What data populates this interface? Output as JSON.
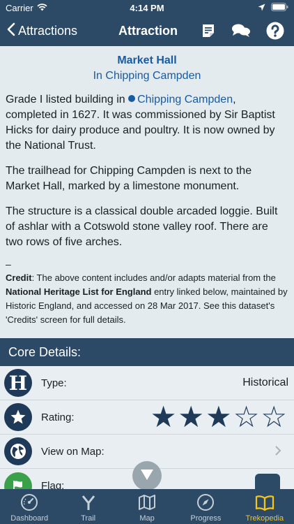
{
  "status": {
    "carrier": "Carrier",
    "time": "4:14 PM"
  },
  "nav": {
    "back_label": "Attractions",
    "title": "Attraction"
  },
  "article": {
    "title": "Market Hall",
    "subtitle": "In Chipping Campden",
    "p1_before": "Grade I listed building in ",
    "p1_link": "Chipping Campden",
    "p1_after": ", completed in 1627. It was commissioned by Sir Baptist Hicks for dairy produce and poultry. It is now owned by the National Trust.",
    "p2": "The trailhead for Chipping Campden is next to the Market Hall, marked by a limestone monument.",
    "p3": "The structure is a classical double arcaded loggie. Built of ashlar with a Cotswold stone valley roof. There are two rows of five arches.",
    "dash": "–",
    "credit_label": "Credit",
    "credit_text1": ": The above content includes and/or adapts material from the ",
    "credit_bold": "National Heritage List for England",
    "credit_text2": " entry linked below, maintained by Historic England, and accessed on 28 Mar 2017. See this dataset's 'Credits' screen for full details."
  },
  "core": {
    "header": "Core Details:",
    "type_label": "Type:",
    "type_value": "Historical",
    "type_icon_letter": "H",
    "rating_label": "Rating:",
    "rating": 3,
    "rating_max": 5,
    "map_label": "View on Map:",
    "flag_label": "Flag:"
  },
  "tabs": [
    {
      "label": "Dashboard",
      "icon": "dashboard-icon"
    },
    {
      "label": "Trail",
      "icon": "trail-icon"
    },
    {
      "label": "Map",
      "icon": "map-icon"
    },
    {
      "label": "Progress",
      "icon": "compass-icon"
    },
    {
      "label": "Trekopedia",
      "icon": "book-icon"
    }
  ],
  "colors": {
    "nav": "#2c4a66",
    "link": "#1a5aa0",
    "active_tab": "#f5c518",
    "icon_bg": "#1e3a58"
  }
}
